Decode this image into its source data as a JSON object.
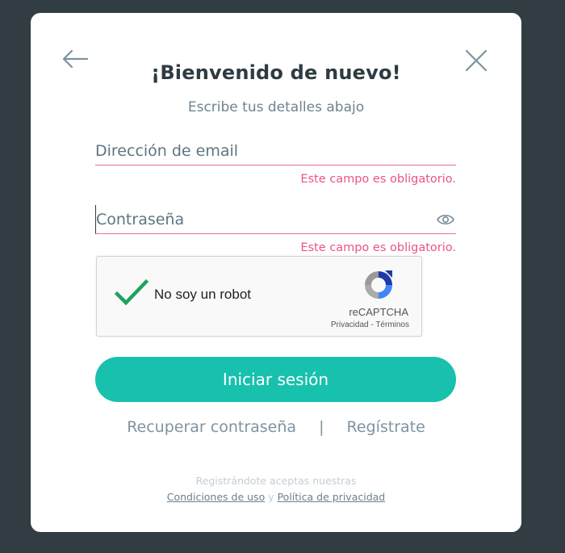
{
  "login_modal": {
    "title": "¡Bienvenido de nuevo!",
    "subtitle": "Escribe tus detalles abajo",
    "email": {
      "placeholder": "Dirección de email",
      "value": "",
      "error": "Este campo es obligatorio."
    },
    "password": {
      "placeholder": "Contraseña",
      "value": "",
      "error": "Este campo es obligatorio."
    },
    "captcha": {
      "label": "No soy un robot",
      "checked": true,
      "brand": "reCAPTCHA",
      "privacy": "Privacidad",
      "separator": "-",
      "terms": "Términos"
    },
    "submit_label": "Iniciar sesión",
    "recover_label": "Recuperar contraseña",
    "link_separator": "|",
    "register_label": "Regístrate",
    "legal": {
      "intro": "Registrándote aceptas nuestras",
      "terms_link": "Condiciones de uso",
      "joiner": "y",
      "privacy_link": "Política de privacidad"
    },
    "icons": {
      "back": "arrow-left-icon",
      "close": "close-icon",
      "eye": "eye-icon",
      "check": "checkmark-icon",
      "recaptcha": "recaptcha-logo-icon"
    },
    "colors": {
      "accent": "#17c1ad",
      "error": "#e9548a",
      "backdrop": "#313d43",
      "check": "#1fa15f"
    }
  }
}
